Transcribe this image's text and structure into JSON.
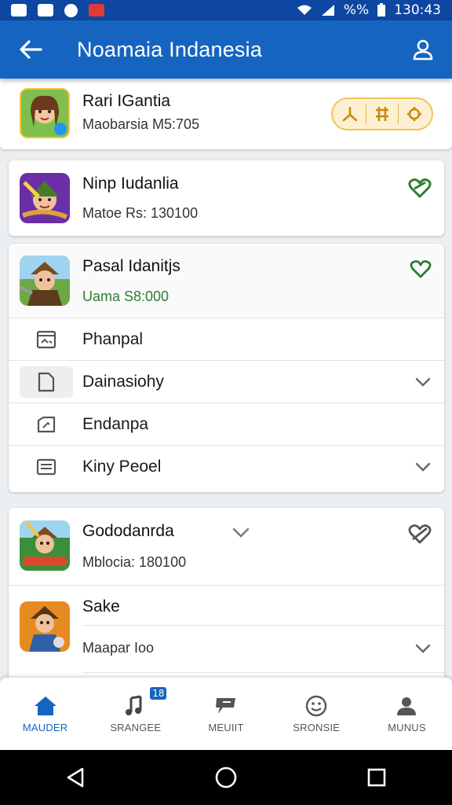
{
  "status_bar": {
    "indicator": "%%",
    "time": "130:43"
  },
  "app_bar": {
    "title": "Noamaia Indanesia"
  },
  "games": [
    {
      "title": "Rari IGantia",
      "subtitle": "Maobarsia M5:705"
    },
    {
      "title": "Ninp Iudanlia",
      "subtitle": "Matoe Rs: 130100"
    },
    {
      "title": "Pasal Idanitjs",
      "subtitle": "Uama S8:000"
    },
    {
      "title": "Gododanrda",
      "subtitle": "Mblocia: 180100"
    },
    {
      "title": "Sake",
      "subtitle": "Maapar Ioo"
    }
  ],
  "menu_items": [
    {
      "label": "Phanpal"
    },
    {
      "label": "Dainasiohy"
    },
    {
      "label": "Endanpa"
    },
    {
      "label": "Kiny Peoel"
    }
  ],
  "bottom_nav": [
    {
      "label": "MAUDER"
    },
    {
      "label": "SRANGEE",
      "badge": "18"
    },
    {
      "label": "MEUIIT"
    },
    {
      "label": "SRONSIE"
    },
    {
      "label": "MUNUS"
    }
  ],
  "colors": {
    "primary": "#1565c0",
    "status": "#0d47a1",
    "heart_green": "#2e7d32",
    "pill_bg": "#fdf0d2"
  }
}
